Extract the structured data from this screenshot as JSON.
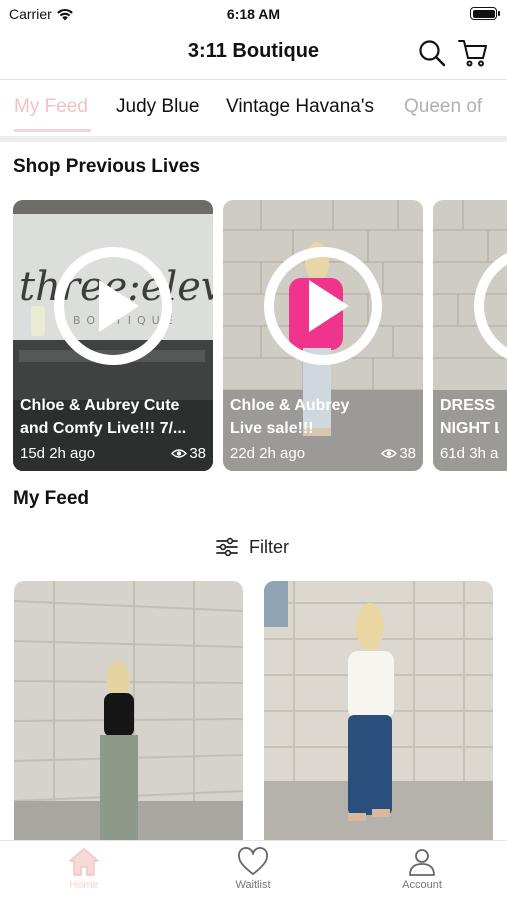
{
  "status_bar": {
    "carrier": "Carrier",
    "time": "6:18 AM"
  },
  "header": {
    "title": "3:11 Boutique"
  },
  "tabs": [
    {
      "label": "My Feed",
      "active": true
    },
    {
      "label": "Judy Blue"
    },
    {
      "label": "Vintage Havana's"
    },
    {
      "label": "Queen of"
    }
  ],
  "lives": {
    "section_title": "Shop Previous Lives",
    "items": [
      {
        "title_line1": "Chloe & Aubrey Cute",
        "title_line2": "and Comfy Live!!! 7/...",
        "time": "15d 2h ago",
        "views": "38"
      },
      {
        "title_line1": "Chloe & Aubrey",
        "title_line2": "Live sale!!!",
        "time": "22d 2h ago",
        "views": "38"
      },
      {
        "title_line1": "DRESS S",
        "title_line2": "NIGHT L",
        "time": "61d 3h a",
        "views": ""
      }
    ]
  },
  "feed": {
    "section_title": "My Feed",
    "filter_label": "Filter"
  },
  "bottom_nav": [
    {
      "label": "Home",
      "icon": "home-icon",
      "active": true
    },
    {
      "label": "Waitlist",
      "icon": "heart-icon"
    },
    {
      "label": "Account",
      "icon": "person-icon"
    }
  ],
  "colors": {
    "accent_pink": "#f3c1c4",
    "hot_pink": "#f0348c",
    "text": "#111111"
  }
}
